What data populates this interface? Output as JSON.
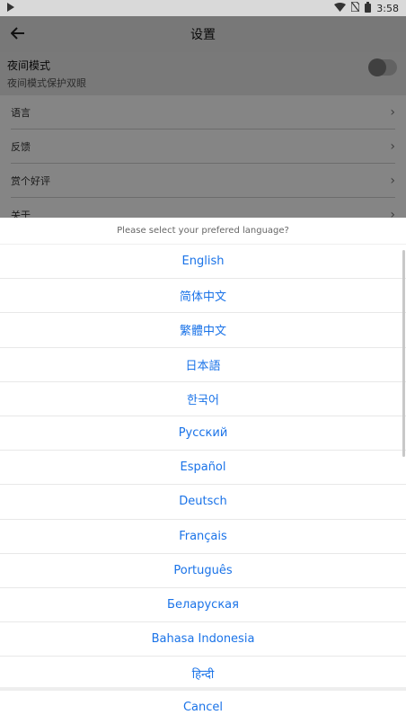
{
  "status_bar": {
    "time": "3:58"
  },
  "header": {
    "title": "设置"
  },
  "settings": {
    "night_mode": {
      "title": "夜间模式",
      "subtitle": "夜间模式保护双眼"
    },
    "rows": [
      {
        "label": "语言"
      },
      {
        "label": "反馈"
      },
      {
        "label": "赏个好评"
      },
      {
        "label": "关于"
      }
    ]
  },
  "dialog": {
    "prompt": "Please select your prefered language?",
    "languages": [
      "English",
      "简体中文",
      "繁體中文",
      "日本語",
      "한국어",
      "Русский",
      "Español",
      "Deutsch",
      "Français",
      "Português",
      "Беларуская",
      "Bahasa Indonesia",
      "हिन्दी"
    ],
    "cancel_label": "Cancel"
  },
  "colors": {
    "accent": "#1a73e8",
    "overlay": "rgba(0,0,0,0.48)"
  },
  "icons": {
    "back": "arrow-left-icon",
    "chevron": "chevron-right-icon",
    "wifi": "wifi-icon",
    "battery": "battery-icon"
  }
}
